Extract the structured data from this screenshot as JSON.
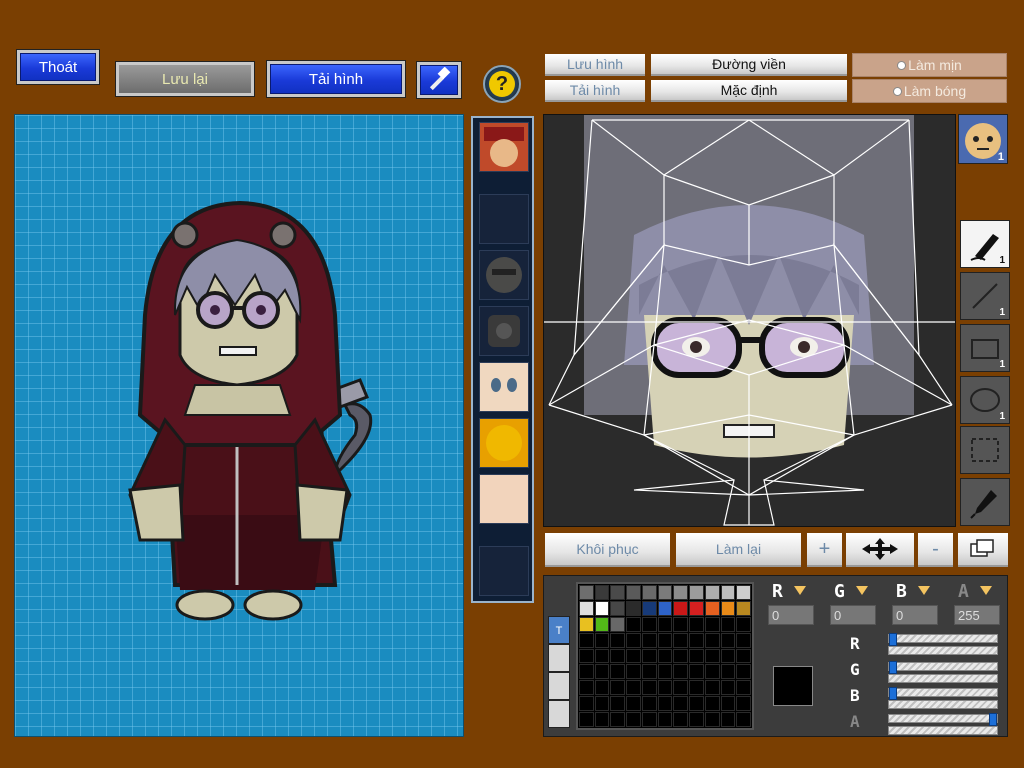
{
  "toolbar": {
    "exit_label": "Thoát",
    "save_label": "Lưu lại",
    "load_label": "Tải hình",
    "help_symbol": "?"
  },
  "editor_controls": {
    "save_image_label": "Lưu hình",
    "load_image_label": "Tải hình",
    "outline_label": "Đường viền",
    "default_label": "Mặc định",
    "smooth_label": "Làm mịn",
    "shade_label": "Làm bóng",
    "restore_label": "Khôi phục",
    "redo_label": "Làm lại",
    "zoom_in_symbol": "+",
    "zoom_out_symbol": "-"
  },
  "tools": [
    {
      "name": "pen-tool",
      "count": "1"
    },
    {
      "name": "line-tool",
      "count": "1"
    },
    {
      "name": "rectangle-tool",
      "count": "1"
    },
    {
      "name": "ellipse-tool",
      "count": "1"
    },
    {
      "name": "selection-tool",
      "count": ""
    },
    {
      "name": "eyedropper-tool",
      "count": ""
    }
  ],
  "face_thumb_count": "1",
  "color": {
    "r_value": "0",
    "g_value": "0",
    "b_value": "0",
    "a_value": "255",
    "current_hex": "#000000"
  },
  "palette_tab_label": "T",
  "palette_swatches": [
    "#6e6e6e",
    "#3a3a3a",
    "#4a4a4a",
    "#5a5a5a",
    "#6a6a6a",
    "#7b7b7b",
    "#8c8c8c",
    "#9c9c9c",
    "#adadad",
    "#bdbdbd",
    "#cecece",
    "#dedede",
    "#ffffff",
    "#474747",
    "#2b2b2b",
    "#173a78",
    "#2e63c8",
    "#c81818",
    "#d42020",
    "#e46020",
    "#e88a18",
    "#b88820",
    "#e8c020",
    "#52b818",
    "#686868",
    "#000000",
    "#000000",
    "#000000",
    "#000000",
    "#000000",
    "#000000",
    "#000000",
    "#000000"
  ],
  "colors": {
    "background": "#7a3f02",
    "canvas_blue": "#1a8cc0",
    "button_blue": "#1a3ad8",
    "hood_red": "#5a1420",
    "hair_gray": "#8e8ea8"
  }
}
